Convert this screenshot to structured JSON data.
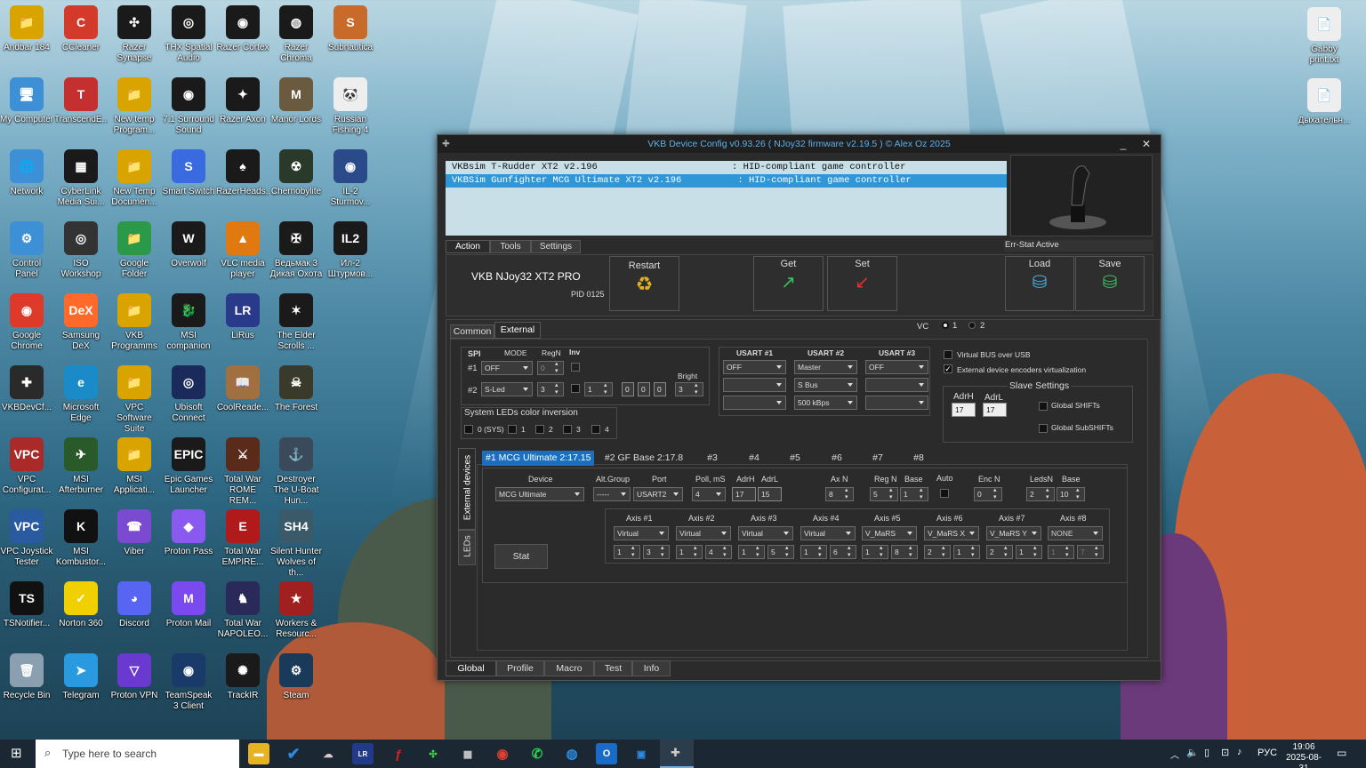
{
  "desktop_icons": [
    {
      "label": "Andbar 184",
      "color": "#d9a400",
      "glyph": "📁"
    },
    {
      "label": "CCleaner",
      "color": "#d43a2a",
      "glyph": "C"
    },
    {
      "label": "Razer Synapse",
      "color": "#1a1a1a",
      "glyph": "✣"
    },
    {
      "label": "THX Spatial Audio",
      "color": "#1a1a1a",
      "glyph": "◎"
    },
    {
      "label": "Razer Cortex",
      "color": "#1a1a1a",
      "glyph": "◉"
    },
    {
      "label": "Razer Chroma",
      "color": "#1a1a1a",
      "glyph": "◍"
    },
    {
      "label": "Subnautica",
      "color": "#c86a2a",
      "glyph": "S"
    },
    {
      "label": "My Computer",
      "color": "#3d8fd6",
      "glyph": "🖥"
    },
    {
      "label": "TranscendE...",
      "color": "#c43030",
      "glyph": "T"
    },
    {
      "label": "New temp Program...",
      "color": "#d9a400",
      "glyph": "📁"
    },
    {
      "label": "7.1 Surround Sound",
      "color": "#1a1a1a",
      "glyph": "◉"
    },
    {
      "label": "Razer Axon",
      "color": "#1a1a1a",
      "glyph": "✦"
    },
    {
      "label": "Manor Lords",
      "color": "#6a5a40",
      "glyph": "M"
    },
    {
      "label": "Russian Fishing 4",
      "color": "#eee",
      "glyph": "🐼"
    },
    {
      "label": "Network",
      "color": "#3d8fd6",
      "glyph": "🌐"
    },
    {
      "label": "CyberLink Media Sui...",
      "color": "#1a1a1a",
      "glyph": "▦"
    },
    {
      "label": "New Temp Documen...",
      "color": "#d9a400",
      "glyph": "📁"
    },
    {
      "label": "Smart Switch",
      "color": "#3a6ae0",
      "glyph": "S"
    },
    {
      "label": "RazerHeads...",
      "color": "#1a1a1a",
      "glyph": "♠"
    },
    {
      "label": "Chernobylite",
      "color": "#2a3a2a",
      "glyph": "☢"
    },
    {
      "label": "IL-2 Sturmov...",
      "color": "#2a4a8a",
      "glyph": "◉"
    },
    {
      "label": "Control Panel",
      "color": "#3d8fd6",
      "glyph": "⚙"
    },
    {
      "label": "ISO Workshop",
      "color": "#333",
      "glyph": "◎"
    },
    {
      "label": "Google Folder",
      "color": "#2a9a4a",
      "glyph": "📁"
    },
    {
      "label": "Overwolf",
      "color": "#1a1a1a",
      "glyph": "W"
    },
    {
      "label": "VLC media player",
      "color": "#e07a10",
      "glyph": "▲"
    },
    {
      "label": "Ведьмак 3 Дикая Охота",
      "color": "#1a1a1a",
      "glyph": "✠"
    },
    {
      "label": "Ил-2 Штурмов...",
      "color": "#1a1a1a",
      "glyph": "IL2"
    },
    {
      "label": "Google Chrome",
      "color": "#dd3a2a",
      "glyph": "◉"
    },
    {
      "label": "Samsung DeX",
      "color": "#ff6a2a",
      "glyph": "DeX"
    },
    {
      "label": "VKB Programms",
      "color": "#d9a400",
      "glyph": "📁"
    },
    {
      "label": "MSI companion",
      "color": "#1a1a1a",
      "glyph": "🐉"
    },
    {
      "label": "LiRus",
      "color": "#2a3a8a",
      "glyph": "LR"
    },
    {
      "label": "The Elder Scrolls ...",
      "color": "#1a1a1a",
      "glyph": "✶"
    },
    {
      "label": "",
      "color": "transparent",
      "glyph": ""
    },
    {
      "label": "VKBDevCf...",
      "color": "#2a2a2a",
      "glyph": "✚"
    },
    {
      "label": "Microsoft Edge",
      "color": "#1a8ac8",
      "glyph": "e"
    },
    {
      "label": "VPC Software Suite",
      "color": "#d9a400",
      "glyph": "📁"
    },
    {
      "label": "Ubisoft Connect",
      "color": "#1a2a5a",
      "glyph": "◎"
    },
    {
      "label": "CoolReade...",
      "color": "#a07040",
      "glyph": "📖"
    },
    {
      "label": "The Forest",
      "color": "#3a3a2a",
      "glyph": "☠"
    },
    {
      "label": "",
      "color": "transparent",
      "glyph": ""
    },
    {
      "label": "VPC Configurat...",
      "color": "#aa2a2a",
      "glyph": "VPC"
    },
    {
      "label": "MSI Afterburner",
      "color": "#2a5a2a",
      "glyph": "✈"
    },
    {
      "label": "MSI Applicati...",
      "color": "#d9a400",
      "glyph": "📁"
    },
    {
      "label": "Epic Games Launcher",
      "color": "#1a1a1a",
      "glyph": "EPIC"
    },
    {
      "label": "Total War ROME REM...",
      "color": "#5a2a1a",
      "glyph": "⚔"
    },
    {
      "label": "Destroyer The U-Boat Hun...",
      "color": "#3a4a5a",
      "glyph": "⚓"
    },
    {
      "label": "",
      "color": "transparent",
      "glyph": ""
    },
    {
      "label": "VPC Joystick Tester",
      "color": "#2a5aa0",
      "glyph": "VPC"
    },
    {
      "label": "MSI Kombustor...",
      "color": "#111",
      "glyph": "K"
    },
    {
      "label": "Viber",
      "color": "#7a4ad0",
      "glyph": "☎"
    },
    {
      "label": "Proton Pass",
      "color": "#8a5af0",
      "glyph": "◆"
    },
    {
      "label": "Total War EMPIRE...",
      "color": "#b01a1a",
      "glyph": "E"
    },
    {
      "label": "Silent Hunter Wolves of th...",
      "color": "#3a5a6a",
      "glyph": "SH4"
    },
    {
      "label": "",
      "color": "transparent",
      "glyph": ""
    },
    {
      "label": "TSNotifier...",
      "color": "#111",
      "glyph": "TS"
    },
    {
      "label": "Norton 360",
      "color": "#f0d000",
      "glyph": "✓"
    },
    {
      "label": "Discord",
      "color": "#5865f2",
      "glyph": "◕"
    },
    {
      "label": "Proton Mail",
      "color": "#7a4af0",
      "glyph": "M"
    },
    {
      "label": "Total War NAPOLEO...",
      "color": "#2a2a5a",
      "glyph": "♞"
    },
    {
      "label": "Workers & Resourc...",
      "color": "#a02020",
      "glyph": "★"
    },
    {
      "label": "",
      "color": "transparent",
      "glyph": ""
    },
    {
      "label": "Recycle Bin",
      "color": "#8aa0b0",
      "glyph": "🗑"
    },
    {
      "label": "Telegram",
      "color": "#2a9ae0",
      "glyph": "➤"
    },
    {
      "label": "Proton VPN",
      "color": "#6a3ad0",
      "glyph": "▽"
    },
    {
      "label": "TeamSpeak 3 Client",
      "color": "#1a3a6a",
      "glyph": "◉"
    },
    {
      "label": "TrackIR",
      "color": "#1a1a1a",
      "glyph": "✺"
    },
    {
      "label": "Steam",
      "color": "#1a3a5a",
      "glyph": "⚙"
    }
  ],
  "right_icons": [
    {
      "label": "Gabby print.txt",
      "glyph": "📄"
    },
    {
      "label": "Дыхательн...",
      "glyph": "📄"
    }
  ],
  "window": {
    "title": "VKB Device Config v0.93.26 ( NJoy32 firmware v2.19.5 ) © Alex Oz 2025",
    "minimize": "_",
    "close": "✕",
    "devices": [
      {
        "text": "VKBsim T-Rudder XT2 v2.196                        : HID-compliant game controller",
        "selected": false
      },
      {
        "text": "VKBSim Gunfighter MCG Ultimate XT2 v2.196          : HID-compliant game controller",
        "selected": true
      }
    ],
    "err_stat": "Err-Stat Active",
    "top_tabs": [
      "Action",
      "Tools",
      "Settings"
    ],
    "device_name": "VKB NJoy32 XT2 PRO",
    "pid": "PID 0125",
    "restart": "Restart",
    "get": "Get",
    "set": "Set",
    "load": "Load",
    "save": "Save",
    "vc": {
      "label": "VC",
      "opt1": "1",
      "opt2": "2"
    },
    "sub_tabs": [
      "Common",
      "External"
    ],
    "spi": {
      "spi": "SPI",
      "mode": "MODE",
      "regn": "RegN",
      "inv": "Inv",
      "bright": "Bright",
      "r1": {
        "label": "#1",
        "mode": "OFF",
        "regn": "0"
      },
      "r2": {
        "label": "#2",
        "mode": "S-Led",
        "regn": "3",
        "a": "1",
        "b": "0",
        "c": "0",
        "d": "0",
        "bright": "3"
      }
    },
    "sysled": {
      "title": "System LEDs color inversion",
      "items": [
        "0 (SYS)",
        "1",
        "2",
        "3",
        "4"
      ]
    },
    "usart": {
      "h1": "USART #1",
      "h2": "USART #2",
      "h3": "USART #3",
      "rows": [
        [
          "OFF",
          "Master",
          "OFF"
        ],
        [
          "",
          "S Bus",
          ""
        ],
        [
          "",
          "500 kBps",
          ""
        ]
      ]
    },
    "virtual_bus": "Virtual BUS over USB",
    "ext_enc": "External device encoders virtualization",
    "slave": {
      "title": "Slave Settings",
      "adrh": "AdrH",
      "adrl": "AdrL",
      "adrh_v": "17",
      "adrl_v": "17",
      "global_shifts": "Global SHIFTs",
      "global_subshifts": "Global SubSHIFTs"
    },
    "side_tabs": [
      "External devices",
      "LEDs"
    ],
    "ext_tabs": [
      "#1 MCG Ultimate 2:17.15",
      "#2 GF Base 2:17.8",
      "#3",
      "#4",
      "#5",
      "#6",
      "#7",
      "#8"
    ],
    "ext": {
      "device_h": "Device",
      "device": "MCG Ultimate",
      "altgroup_h": "Alt.Group",
      "altgroup": "-----",
      "port_h": "Port",
      "port": "USART2",
      "poll_h": "Poll, mS",
      "poll": "4",
      "adrh_h": "AdrH",
      "adrh": "17",
      "adrl_h": "AdrL",
      "adrl": "15",
      "axn_h": "Ax N",
      "axn": "8",
      "regn_h": "Reg N",
      "regn": "5",
      "base_h": "Base",
      "base": "1",
      "auto_h": "Auto",
      "encn_h": "Enc N",
      "encn": "0",
      "ledsn_h": "LedsN",
      "ledsn": "2",
      "base2_h": "Base",
      "base2": "10",
      "stat": "Stat",
      "axes": [
        {
          "h": "Axis #1",
          "type": "Virtual",
          "a": "1",
          "b": "3"
        },
        {
          "h": "Axis #2",
          "type": "Virtual",
          "a": "1",
          "b": "4"
        },
        {
          "h": "Axis #3",
          "type": "Virtual",
          "a": "1",
          "b": "5"
        },
        {
          "h": "Axis #4",
          "type": "Virtual",
          "a": "1",
          "b": "6"
        },
        {
          "h": "Axis #5",
          "type": "V_MaRS",
          "a": "1",
          "b": "8"
        },
        {
          "h": "Axis #6",
          "type": "V_MaRS X",
          "a": "2",
          "b": "1"
        },
        {
          "h": "Axis #7",
          "type": "V_MaRS Y",
          "a": "2",
          "b": "1"
        },
        {
          "h": "Axis #8",
          "type": "NONE",
          "a": "1",
          "b": "7"
        }
      ]
    },
    "bottom_tabs": [
      "Global",
      "Profile",
      "Macro",
      "Test",
      "Info"
    ]
  },
  "taskbar": {
    "search_placeholder": "Type here to search",
    "lang": "РУС",
    "time": "19:06",
    "date": "2025-08-31"
  }
}
